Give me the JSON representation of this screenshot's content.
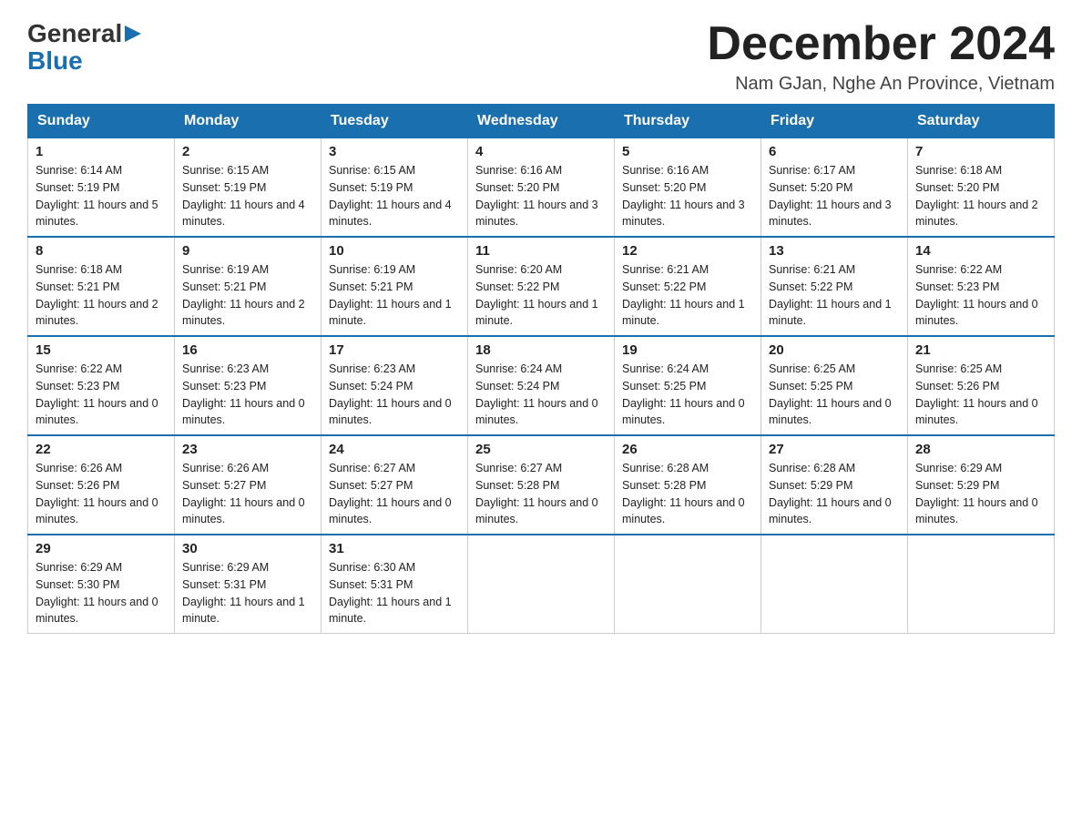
{
  "logo": {
    "general": "General",
    "blue": "Blue",
    "arrow": "▶"
  },
  "title": {
    "month_year": "December 2024",
    "location": "Nam GJan, Nghe An Province, Vietnam"
  },
  "header_days": [
    "Sunday",
    "Monday",
    "Tuesday",
    "Wednesday",
    "Thursday",
    "Friday",
    "Saturday"
  ],
  "weeks": [
    [
      {
        "day": "1",
        "sunrise": "6:14 AM",
        "sunset": "5:19 PM",
        "daylight": "11 hours and 5 minutes."
      },
      {
        "day": "2",
        "sunrise": "6:15 AM",
        "sunset": "5:19 PM",
        "daylight": "11 hours and 4 minutes."
      },
      {
        "day": "3",
        "sunrise": "6:15 AM",
        "sunset": "5:19 PM",
        "daylight": "11 hours and 4 minutes."
      },
      {
        "day": "4",
        "sunrise": "6:16 AM",
        "sunset": "5:20 PM",
        "daylight": "11 hours and 3 minutes."
      },
      {
        "day": "5",
        "sunrise": "6:16 AM",
        "sunset": "5:20 PM",
        "daylight": "11 hours and 3 minutes."
      },
      {
        "day": "6",
        "sunrise": "6:17 AM",
        "sunset": "5:20 PM",
        "daylight": "11 hours and 3 minutes."
      },
      {
        "day": "7",
        "sunrise": "6:18 AM",
        "sunset": "5:20 PM",
        "daylight": "11 hours and 2 minutes."
      }
    ],
    [
      {
        "day": "8",
        "sunrise": "6:18 AM",
        "sunset": "5:21 PM",
        "daylight": "11 hours and 2 minutes."
      },
      {
        "day": "9",
        "sunrise": "6:19 AM",
        "sunset": "5:21 PM",
        "daylight": "11 hours and 2 minutes."
      },
      {
        "day": "10",
        "sunrise": "6:19 AM",
        "sunset": "5:21 PM",
        "daylight": "11 hours and 1 minute."
      },
      {
        "day": "11",
        "sunrise": "6:20 AM",
        "sunset": "5:22 PM",
        "daylight": "11 hours and 1 minute."
      },
      {
        "day": "12",
        "sunrise": "6:21 AM",
        "sunset": "5:22 PM",
        "daylight": "11 hours and 1 minute."
      },
      {
        "day": "13",
        "sunrise": "6:21 AM",
        "sunset": "5:22 PM",
        "daylight": "11 hours and 1 minute."
      },
      {
        "day": "14",
        "sunrise": "6:22 AM",
        "sunset": "5:23 PM",
        "daylight": "11 hours and 0 minutes."
      }
    ],
    [
      {
        "day": "15",
        "sunrise": "6:22 AM",
        "sunset": "5:23 PM",
        "daylight": "11 hours and 0 minutes."
      },
      {
        "day": "16",
        "sunrise": "6:23 AM",
        "sunset": "5:23 PM",
        "daylight": "11 hours and 0 minutes."
      },
      {
        "day": "17",
        "sunrise": "6:23 AM",
        "sunset": "5:24 PM",
        "daylight": "11 hours and 0 minutes."
      },
      {
        "day": "18",
        "sunrise": "6:24 AM",
        "sunset": "5:24 PM",
        "daylight": "11 hours and 0 minutes."
      },
      {
        "day": "19",
        "sunrise": "6:24 AM",
        "sunset": "5:25 PM",
        "daylight": "11 hours and 0 minutes."
      },
      {
        "day": "20",
        "sunrise": "6:25 AM",
        "sunset": "5:25 PM",
        "daylight": "11 hours and 0 minutes."
      },
      {
        "day": "21",
        "sunrise": "6:25 AM",
        "sunset": "5:26 PM",
        "daylight": "11 hours and 0 minutes."
      }
    ],
    [
      {
        "day": "22",
        "sunrise": "6:26 AM",
        "sunset": "5:26 PM",
        "daylight": "11 hours and 0 minutes."
      },
      {
        "day": "23",
        "sunrise": "6:26 AM",
        "sunset": "5:27 PM",
        "daylight": "11 hours and 0 minutes."
      },
      {
        "day": "24",
        "sunrise": "6:27 AM",
        "sunset": "5:27 PM",
        "daylight": "11 hours and 0 minutes."
      },
      {
        "day": "25",
        "sunrise": "6:27 AM",
        "sunset": "5:28 PM",
        "daylight": "11 hours and 0 minutes."
      },
      {
        "day": "26",
        "sunrise": "6:28 AM",
        "sunset": "5:28 PM",
        "daylight": "11 hours and 0 minutes."
      },
      {
        "day": "27",
        "sunrise": "6:28 AM",
        "sunset": "5:29 PM",
        "daylight": "11 hours and 0 minutes."
      },
      {
        "day": "28",
        "sunrise": "6:29 AM",
        "sunset": "5:29 PM",
        "daylight": "11 hours and 0 minutes."
      }
    ],
    [
      {
        "day": "29",
        "sunrise": "6:29 AM",
        "sunset": "5:30 PM",
        "daylight": "11 hours and 0 minutes."
      },
      {
        "day": "30",
        "sunrise": "6:29 AM",
        "sunset": "5:31 PM",
        "daylight": "11 hours and 1 minute."
      },
      {
        "day": "31",
        "sunrise": "6:30 AM",
        "sunset": "5:31 PM",
        "daylight": "11 hours and 1 minute."
      },
      null,
      null,
      null,
      null
    ]
  ]
}
